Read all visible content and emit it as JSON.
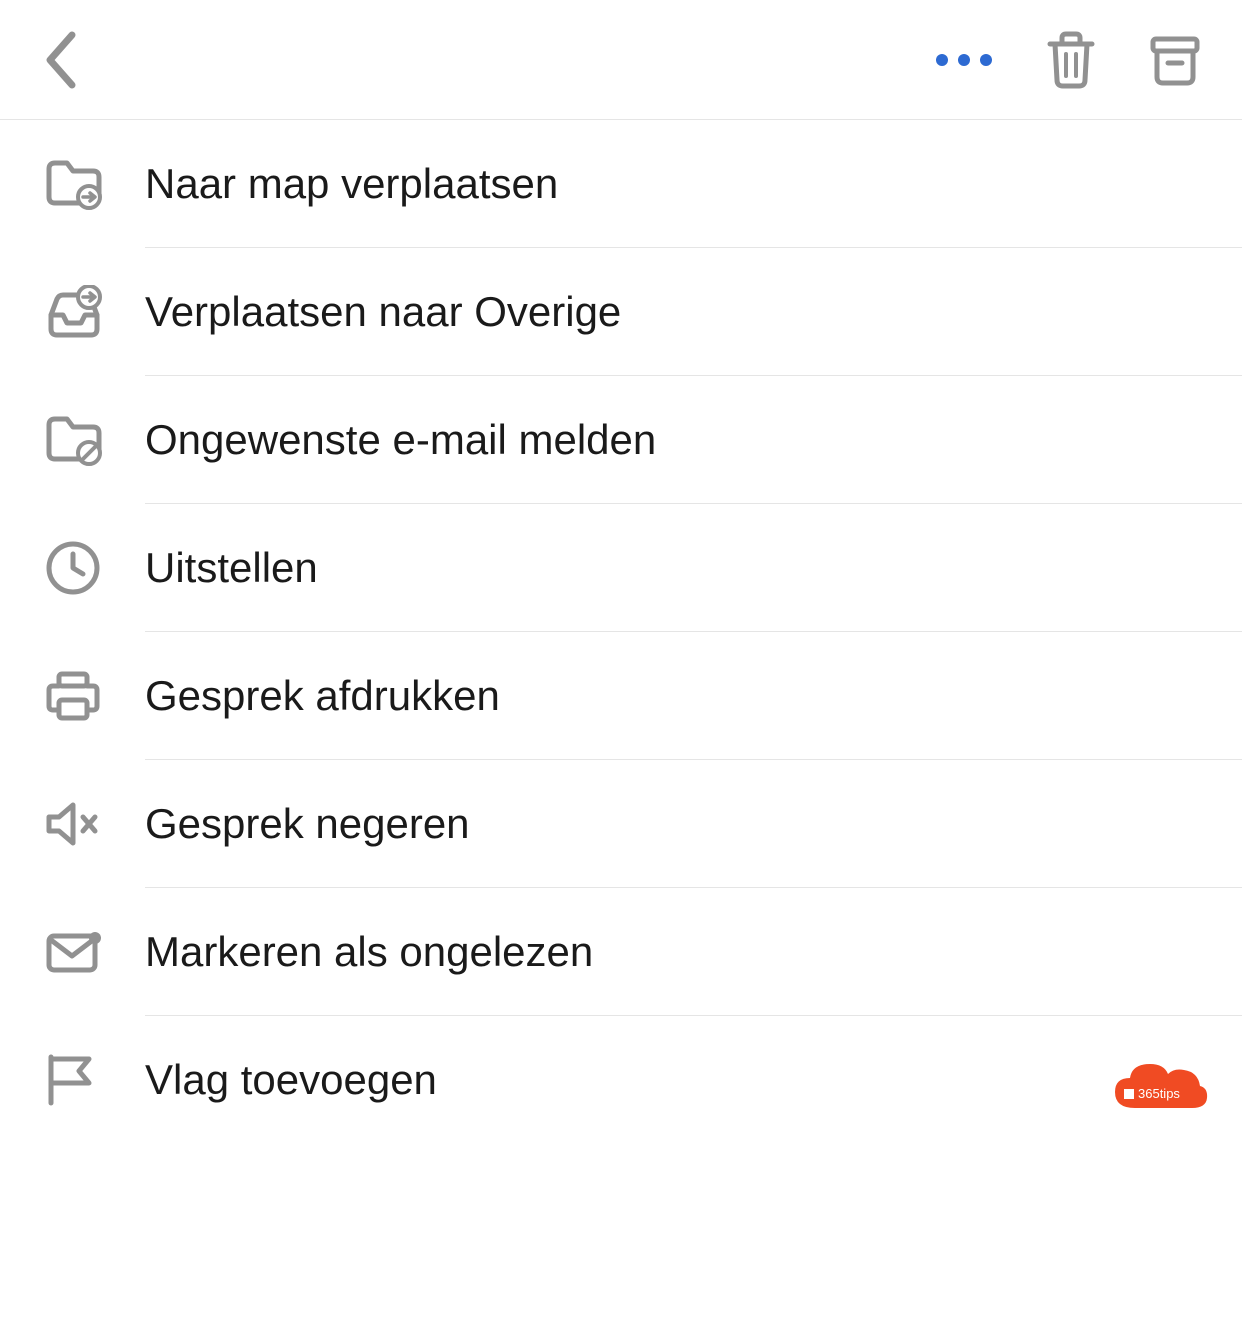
{
  "header": {
    "back": "back",
    "more": "more",
    "trash": "trash",
    "archive": "archive"
  },
  "menu": {
    "items": [
      {
        "icon": "folder-move-icon",
        "label": "Naar map verplaatsen"
      },
      {
        "icon": "inbox-move-icon",
        "label": "Verplaatsen naar Overige"
      },
      {
        "icon": "folder-block-icon",
        "label": "Ongewenste e-mail melden"
      },
      {
        "icon": "clock-icon",
        "label": "Uitstellen"
      },
      {
        "icon": "printer-icon",
        "label": "Gesprek afdrukken"
      },
      {
        "icon": "speaker-mute-icon",
        "label": "Gesprek negeren"
      },
      {
        "icon": "mail-unread-icon",
        "label": "Markeren als ongelezen"
      },
      {
        "icon": "flag-icon",
        "label": "Vlag toevoegen"
      }
    ]
  },
  "badge": {
    "text": "365tips"
  },
  "colors": {
    "icon_gray": "#919191",
    "accent_blue": "#2d6ad2",
    "badge_orange": "#f04b23",
    "text": "#1a1a1a"
  }
}
